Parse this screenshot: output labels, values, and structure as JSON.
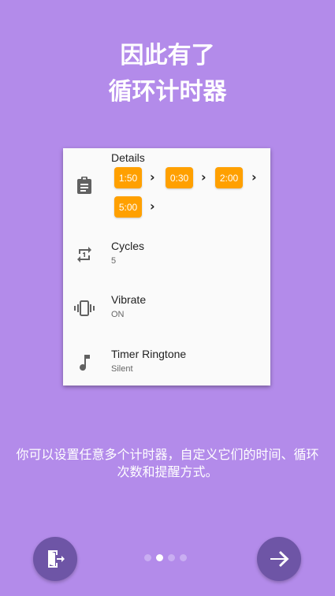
{
  "header": {
    "title_line1": "因此有了",
    "title_line2": "循环计时器"
  },
  "card": {
    "details": {
      "label": "Details",
      "chips": [
        "1:50",
        "0:30",
        "2:00",
        "5:00"
      ]
    },
    "cycles": {
      "label": "Cycles",
      "value": "5"
    },
    "vibrate": {
      "label": "Vibrate",
      "value": "ON"
    },
    "ringtone": {
      "label": "Timer Ringtone",
      "value": "Silent"
    }
  },
  "description": "你可以设置任意多个计时器，自定义它们的时间、循环次数和提醒方式。",
  "pager": {
    "page_count": 4,
    "active_index": 1
  },
  "colors": {
    "background": "#B38BEA",
    "chip": "#FFA000",
    "button": "#6E55A6"
  }
}
